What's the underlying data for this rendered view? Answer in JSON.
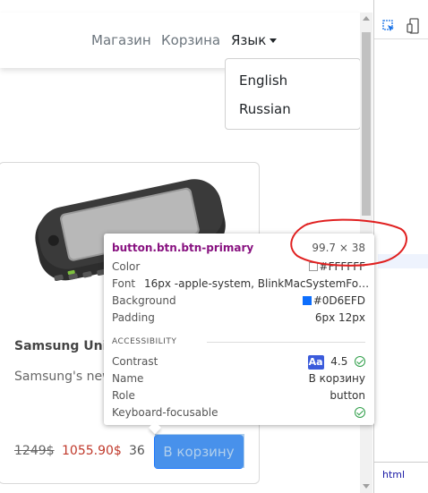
{
  "nav": {
    "shop": "Магазин",
    "cart": "Корзина",
    "language": "Язык"
  },
  "language_menu": {
    "items": [
      "English",
      "Russian"
    ]
  },
  "product": {
    "title": "Samsung Unive",
    "description": "Samsung's new beyond Galaxy",
    "old_price": "1249$",
    "new_price": "1055.90$",
    "stock": "36",
    "buy_label": "В корзину"
  },
  "tooltip": {
    "selector": "button.btn.btn-primary",
    "size": "99.7 × 38",
    "color_label": "Color",
    "color_value": "#FFFFFF",
    "font_label": "Font",
    "font_value": "16px -apple-system, BlinkMacSystemFon…",
    "background_label": "Background",
    "background_value": "#0D6EFD",
    "padding_label": "Padding",
    "padding_value": "6px 12px",
    "accessibility_heading": "ACCESSIBILITY",
    "contrast_label": "Contrast",
    "contrast_badge": "Aa",
    "contrast_value": "4.5",
    "name_label": "Name",
    "name_value": "В корзину",
    "role_label": "Role",
    "role_value": "button",
    "focusable_label": "Keyboard-focusable"
  },
  "devtools": {
    "bottom_tab": "html"
  },
  "colors": {
    "primary": "#0d6efd",
    "annotation": "#e02020",
    "selector": "#881280"
  }
}
